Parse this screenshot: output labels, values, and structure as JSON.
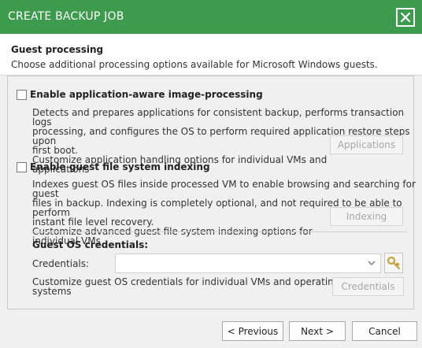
{
  "window": {
    "title": "CREATE BACKUP JOB"
  },
  "header": {
    "title": "Guest processing",
    "subtitle": "Choose additional processing options available for Microsoft Windows guests."
  },
  "app_aware": {
    "label": "Enable application-aware image-processing",
    "checked": false,
    "desc_lines": [
      "Detects and prepares applications for consistent backup, performs transaction logs",
      "processing, and configures the OS to perform required application restore steps upon",
      "first boot."
    ],
    "customize_lines": [
      "Customize application handling options for individual VMs and",
      "applications"
    ],
    "button": "Applications"
  },
  "indexing": {
    "label": "Enable guest file system indexing",
    "checked": false,
    "desc_lines": [
      "Indexes guest OS files inside processed VM to enable browsing and searching for guest",
      "files in backup. Indexing is completely optional, and not required to be able to perform",
      "instant file level recovery."
    ],
    "customize_lines": [
      "Customize advanced guest file system indexing options for",
      "individual VMs"
    ],
    "button": "Indexing"
  },
  "credentials": {
    "heading": "Guest OS credentials:",
    "label": "Credentials:",
    "value": "",
    "customize_lines": [
      "Customize guest OS credentials for individual VMs and operating",
      "systems"
    ],
    "button": "Credentials"
  },
  "footer": {
    "previous": "< Previous",
    "next": "Next >",
    "cancel": "Cancel"
  },
  "colors": {
    "titlebar": "#3c9b4c",
    "key_icon": "#c9a13a"
  }
}
